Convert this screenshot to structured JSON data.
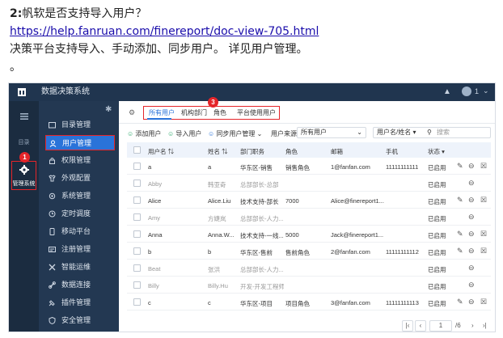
{
  "doc": {
    "question_num": "2:",
    "question_text": "帆软是否支持导入用户？",
    "link": "https://help.fanruan.com/finereport/doc-view-705.html",
    "answer": "决策平台支持导入、手动添加、同步用户。 详见用户管理。",
    "trailing": "。"
  },
  "app": {
    "title": "数据决策系统",
    "user_badge": "1",
    "colors": {
      "topbar": "#20354f",
      "rail": "#1b2c40",
      "menu": "#233852",
      "accent": "#2a73d9",
      "highlight": "#e5252a"
    }
  },
  "rail": {
    "items": [
      {
        "icon": "list-icon",
        "label": ""
      },
      {
        "icon": "directory-icon",
        "label": "目录"
      },
      {
        "icon": "gear-icon",
        "label": "管理系统"
      }
    ]
  },
  "menu": {
    "items": [
      {
        "icon": "folder-icon",
        "label": "目录管理"
      },
      {
        "icon": "user-icon",
        "label": "用户管理"
      },
      {
        "icon": "lock-icon",
        "label": "权限管理"
      },
      {
        "icon": "shirt-icon",
        "label": "外观配置"
      },
      {
        "icon": "gear-icon",
        "label": "系统管理"
      },
      {
        "icon": "clock-icon",
        "label": "定时调度"
      },
      {
        "icon": "mobile-icon",
        "label": "移动平台"
      },
      {
        "icon": "register-icon",
        "label": "注册管理"
      },
      {
        "icon": "ops-icon",
        "label": "智能运维"
      },
      {
        "icon": "link-icon",
        "label": "数据连接"
      },
      {
        "icon": "plugin-icon",
        "label": "插件管理"
      },
      {
        "icon": "shield-icon",
        "label": "安全管理"
      }
    ]
  },
  "badges": {
    "rail": "1",
    "menu": "2",
    "tabs": "3"
  },
  "tabs": [
    "所有用户",
    "机构部门",
    "角色",
    "平台使用用户"
  ],
  "toolbar": {
    "add_user": "添加用户",
    "import_user": "导入用户",
    "sync_user": "同步用户管理",
    "source_label": "用户来源",
    "source_value": "所有用户",
    "search_field": "用户名/姓名",
    "search_placeholder": "搜索"
  },
  "table": {
    "headers": [
      "用户名",
      "姓名",
      "部门职务",
      "角色",
      "邮箱",
      "手机",
      "状态"
    ],
    "rows": [
      {
        "username": "a",
        "name": "a",
        "dept": "华东区-销售",
        "role": "销售角色",
        "email": "1@fanfan.com",
        "phone": "11111111111",
        "status": "已启用",
        "editable": true
      },
      {
        "username": "Abby",
        "name": "韩亚奇",
        "dept": "总部部长-总部",
        "role": "",
        "email": "",
        "phone": "",
        "status": "已启用",
        "editable": false
      },
      {
        "username": "Alice",
        "name": "Alice.Liu",
        "dept": "技术支持-部长",
        "role": "7000",
        "email": "Alice@finereport1...",
        "phone": "",
        "status": "已启用",
        "editable": true
      },
      {
        "username": "Amy",
        "name": "方婕岚",
        "dept": "总部部长-人力...",
        "role": "",
        "email": "",
        "phone": "",
        "status": "已启用",
        "editable": false
      },
      {
        "username": "Anna",
        "name": "Anna.W...",
        "dept": "技术支持-一线...",
        "role": "5000",
        "email": "Jack@finereport1...",
        "phone": "",
        "status": "已启用",
        "editable": true
      },
      {
        "username": "b",
        "name": "b",
        "dept": "华东区-售前",
        "role": "售前角色",
        "email": "2@fanfan.com",
        "phone": "11111111112",
        "status": "已启用",
        "editable": true
      },
      {
        "username": "Beat",
        "name": "张洪",
        "dept": "总部部长-人力...",
        "role": "",
        "email": "",
        "phone": "",
        "status": "已启用",
        "editable": false
      },
      {
        "username": "Billy",
        "name": "Billy.Hu",
        "dept": "开发-开发工程师",
        "role": "",
        "email": "",
        "phone": "",
        "status": "已启用",
        "editable": false
      },
      {
        "username": "c",
        "name": "c",
        "dept": "华东区-项目",
        "role": "项目角色",
        "email": "3@fanfan.com",
        "phone": "11111111113",
        "status": "已启用",
        "editable": true
      }
    ]
  },
  "pager": {
    "page": "1",
    "of": "/6"
  }
}
